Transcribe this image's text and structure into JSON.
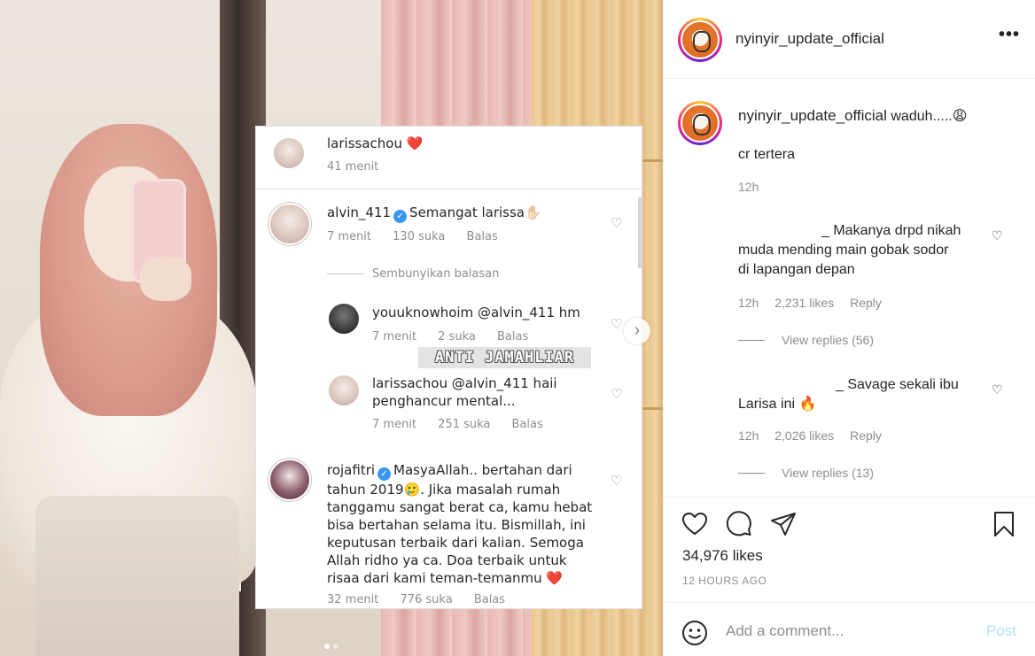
{
  "media": {
    "watermark": "ANTI JAMAHLIAR",
    "carousel": {
      "current": 1,
      "total": 2
    },
    "screenshot": {
      "post_user": "larissachou",
      "post_heart": "❤️",
      "post_time": "41 menit",
      "comments": [
        {
          "user": "alvin_411",
          "verified": true,
          "text": "Semangat larissa✋🏻",
          "time": "7 menit",
          "likes": "130 suka",
          "reply": "Balas"
        },
        {
          "user": "youuknowhoim",
          "text": "@alvin_411 hm",
          "time": "7 menit",
          "likes": "2 suka",
          "reply": "Balas"
        },
        {
          "user": "larissachou",
          "text_line1": "@alvin_411 haii",
          "text_line2": "penghancur mental...",
          "time": "7 menit",
          "likes": "251 suka",
          "reply": "Balas"
        },
        {
          "user": "rojafitri",
          "verified": true,
          "lines": [
            "MasyaAllah.. bertahan dari",
            "tahun 2019🥲. Jika masalah rumah",
            "tanggamu sangat berat ca, kamu hebat",
            "bisa bertahan selama itu. Bismillah, ini",
            "keputusan terbaik dari kalian. Semoga",
            "Allah ridho ya ca. Doa terbaik untuk",
            "risaa dari kami teman-temanmu ❤️"
          ],
          "time": "32 menit",
          "likes": "776 suka",
          "reply": "Balas"
        }
      ],
      "hide_replies": "Sembunyikan balasan"
    }
  },
  "header": {
    "username": "nyinyir_update_official",
    "more_icon": "more-horizontal-icon"
  },
  "caption": {
    "username": "nyinyir_update_official",
    "text": "waduh.....😩",
    "line2": "cr tertera",
    "time": "12h"
  },
  "comments": [
    {
      "line1": "_ Makanya drpd nikah",
      "line2": "muda mending main gobak sodor",
      "line3": "di lapangan depan",
      "time": "12h",
      "likes": "2,231 likes",
      "reply": "Reply",
      "view_replies": "View replies (56)"
    },
    {
      "line1": "_ Savage sekali ibu",
      "line2": "Larisa ini 🔥",
      "time": "12h",
      "likes": "2,026 likes",
      "reply": "Reply",
      "view_replies": "View replies (13)"
    }
  ],
  "actions": {
    "likes": "34,976 likes",
    "ago": "12 HOURS AGO"
  },
  "add_comment": {
    "placeholder": "Add a comment...",
    "post_label": "Post"
  }
}
